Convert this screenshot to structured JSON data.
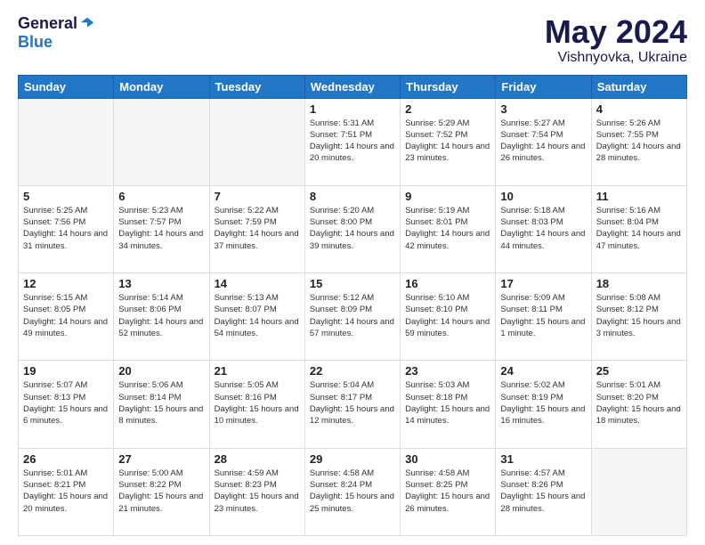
{
  "logo": {
    "general": "General",
    "blue": "Blue"
  },
  "header": {
    "month": "May 2024",
    "location": "Vishnyovka, Ukraine"
  },
  "days_of_week": [
    "Sunday",
    "Monday",
    "Tuesday",
    "Wednesday",
    "Thursday",
    "Friday",
    "Saturday"
  ],
  "weeks": [
    [
      {
        "day": "",
        "info": ""
      },
      {
        "day": "",
        "info": ""
      },
      {
        "day": "",
        "info": ""
      },
      {
        "day": "1",
        "info": "Sunrise: 5:31 AM\nSunset: 7:51 PM\nDaylight: 14 hours\nand 20 minutes."
      },
      {
        "day": "2",
        "info": "Sunrise: 5:29 AM\nSunset: 7:52 PM\nDaylight: 14 hours\nand 23 minutes."
      },
      {
        "day": "3",
        "info": "Sunrise: 5:27 AM\nSunset: 7:54 PM\nDaylight: 14 hours\nand 26 minutes."
      },
      {
        "day": "4",
        "info": "Sunrise: 5:26 AM\nSunset: 7:55 PM\nDaylight: 14 hours\nand 28 minutes."
      }
    ],
    [
      {
        "day": "5",
        "info": "Sunrise: 5:25 AM\nSunset: 7:56 PM\nDaylight: 14 hours\nand 31 minutes."
      },
      {
        "day": "6",
        "info": "Sunrise: 5:23 AM\nSunset: 7:57 PM\nDaylight: 14 hours\nand 34 minutes."
      },
      {
        "day": "7",
        "info": "Sunrise: 5:22 AM\nSunset: 7:59 PM\nDaylight: 14 hours\nand 37 minutes."
      },
      {
        "day": "8",
        "info": "Sunrise: 5:20 AM\nSunset: 8:00 PM\nDaylight: 14 hours\nand 39 minutes."
      },
      {
        "day": "9",
        "info": "Sunrise: 5:19 AM\nSunset: 8:01 PM\nDaylight: 14 hours\nand 42 minutes."
      },
      {
        "day": "10",
        "info": "Sunrise: 5:18 AM\nSunset: 8:03 PM\nDaylight: 14 hours\nand 44 minutes."
      },
      {
        "day": "11",
        "info": "Sunrise: 5:16 AM\nSunset: 8:04 PM\nDaylight: 14 hours\nand 47 minutes."
      }
    ],
    [
      {
        "day": "12",
        "info": "Sunrise: 5:15 AM\nSunset: 8:05 PM\nDaylight: 14 hours\nand 49 minutes."
      },
      {
        "day": "13",
        "info": "Sunrise: 5:14 AM\nSunset: 8:06 PM\nDaylight: 14 hours\nand 52 minutes."
      },
      {
        "day": "14",
        "info": "Sunrise: 5:13 AM\nSunset: 8:07 PM\nDaylight: 14 hours\nand 54 minutes."
      },
      {
        "day": "15",
        "info": "Sunrise: 5:12 AM\nSunset: 8:09 PM\nDaylight: 14 hours\nand 57 minutes."
      },
      {
        "day": "16",
        "info": "Sunrise: 5:10 AM\nSunset: 8:10 PM\nDaylight: 14 hours\nand 59 minutes."
      },
      {
        "day": "17",
        "info": "Sunrise: 5:09 AM\nSunset: 8:11 PM\nDaylight: 15 hours\nand 1 minute."
      },
      {
        "day": "18",
        "info": "Sunrise: 5:08 AM\nSunset: 8:12 PM\nDaylight: 15 hours\nand 3 minutes."
      }
    ],
    [
      {
        "day": "19",
        "info": "Sunrise: 5:07 AM\nSunset: 8:13 PM\nDaylight: 15 hours\nand 6 minutes."
      },
      {
        "day": "20",
        "info": "Sunrise: 5:06 AM\nSunset: 8:14 PM\nDaylight: 15 hours\nand 8 minutes."
      },
      {
        "day": "21",
        "info": "Sunrise: 5:05 AM\nSunset: 8:16 PM\nDaylight: 15 hours\nand 10 minutes."
      },
      {
        "day": "22",
        "info": "Sunrise: 5:04 AM\nSunset: 8:17 PM\nDaylight: 15 hours\nand 12 minutes."
      },
      {
        "day": "23",
        "info": "Sunrise: 5:03 AM\nSunset: 8:18 PM\nDaylight: 15 hours\nand 14 minutes."
      },
      {
        "day": "24",
        "info": "Sunrise: 5:02 AM\nSunset: 8:19 PM\nDaylight: 15 hours\nand 16 minutes."
      },
      {
        "day": "25",
        "info": "Sunrise: 5:01 AM\nSunset: 8:20 PM\nDaylight: 15 hours\nand 18 minutes."
      }
    ],
    [
      {
        "day": "26",
        "info": "Sunrise: 5:01 AM\nSunset: 8:21 PM\nDaylight: 15 hours\nand 20 minutes."
      },
      {
        "day": "27",
        "info": "Sunrise: 5:00 AM\nSunset: 8:22 PM\nDaylight: 15 hours\nand 21 minutes."
      },
      {
        "day": "28",
        "info": "Sunrise: 4:59 AM\nSunset: 8:23 PM\nDaylight: 15 hours\nand 23 minutes."
      },
      {
        "day": "29",
        "info": "Sunrise: 4:58 AM\nSunset: 8:24 PM\nDaylight: 15 hours\nand 25 minutes."
      },
      {
        "day": "30",
        "info": "Sunrise: 4:58 AM\nSunset: 8:25 PM\nDaylight: 15 hours\nand 26 minutes."
      },
      {
        "day": "31",
        "info": "Sunrise: 4:57 AM\nSunset: 8:26 PM\nDaylight: 15 hours\nand 28 minutes."
      },
      {
        "day": "",
        "info": ""
      }
    ]
  ]
}
